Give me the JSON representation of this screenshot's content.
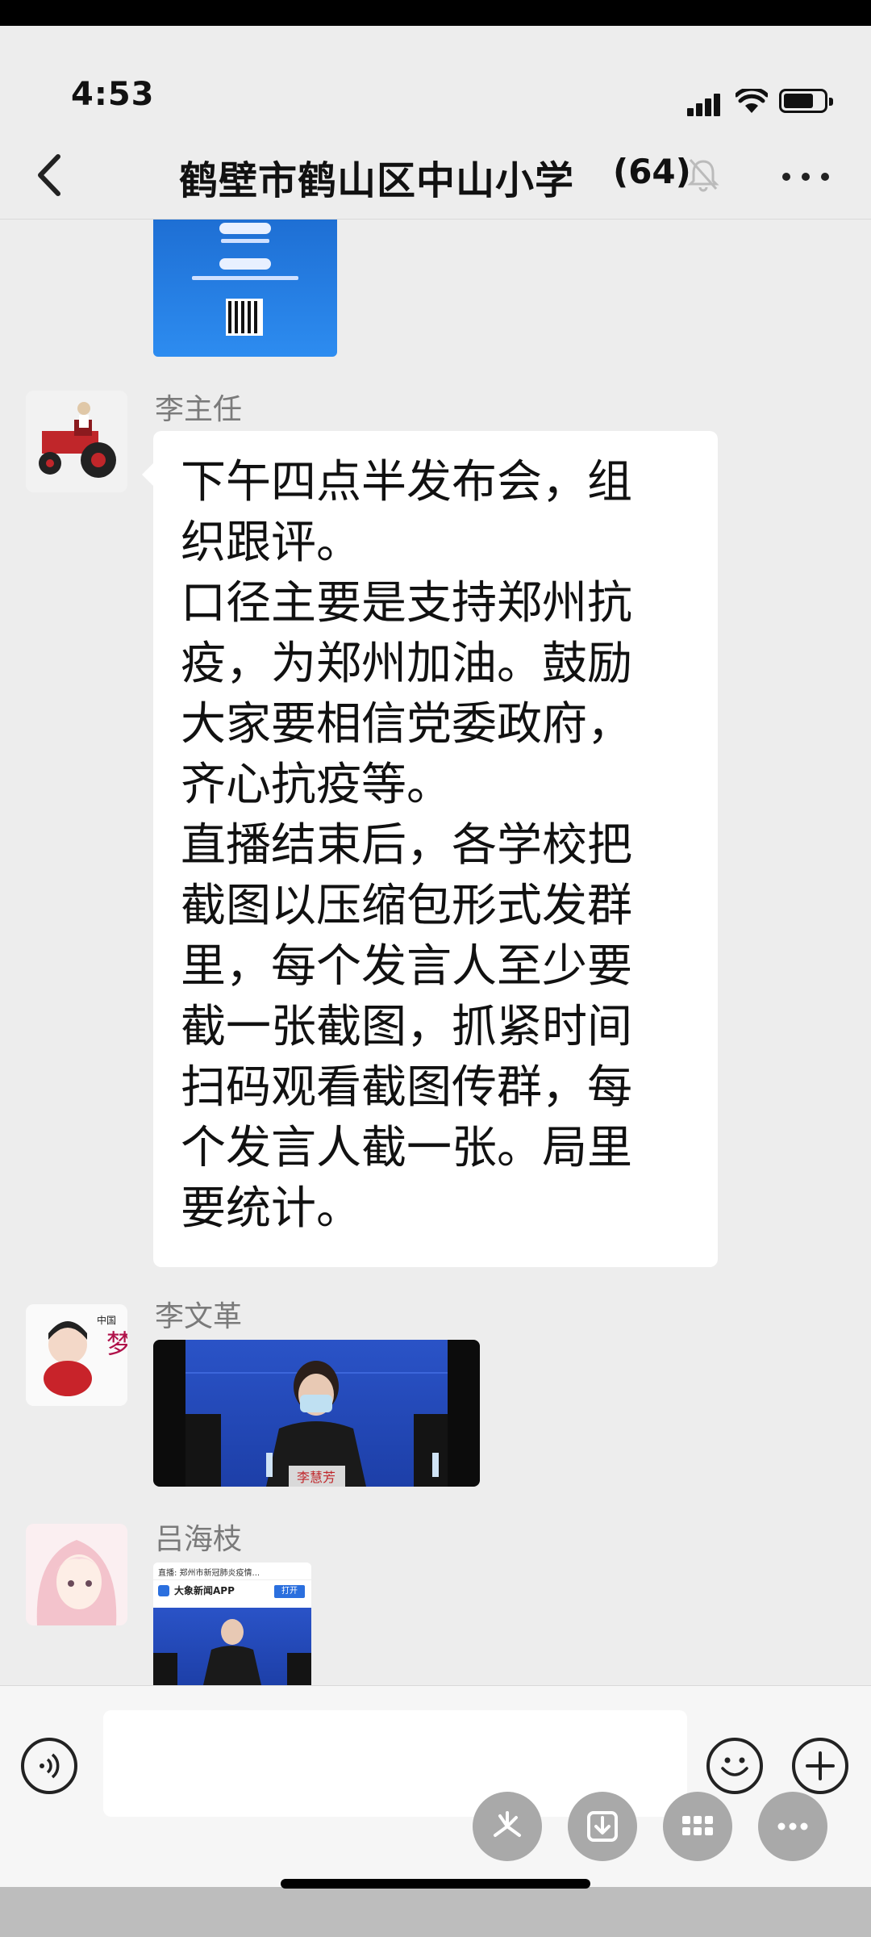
{
  "status_bar": {
    "time": "4:53"
  },
  "header": {
    "title": "鹤壁市鹤山区中山小学",
    "member_count": "(64)"
  },
  "messages": [
    {
      "type": "image",
      "desc_icon": "event-poster-image"
    },
    {
      "type": "text",
      "sender": "李主任",
      "text": "下午四点半发布会，组\n织跟评。\n口径主要是支持郑州抗\n疫，为郑州加油。鼓励\n大家要相信党委政府，\n齐心抗疫等。\n直播结束后，各学校把\n截图以压缩包形式发群\n里，每个发言人至少要\n截一张截图，抓紧时间\n扫码观看截图传群，每\n个发言人截一张。局里\n要统计。"
    },
    {
      "type": "video",
      "sender": "李文革",
      "caption": "李慧芳"
    },
    {
      "type": "image",
      "sender": "吕海枝",
      "thumb_header": "直播: 郑州市新冠肺炎疫情...",
      "thumb_app": "大象新闻APP",
      "thumb_open": "打开"
    }
  ],
  "input": {
    "placeholder": ""
  },
  "icons": {
    "back": "back-arrow-icon",
    "mute": "mute-bell-icon",
    "more": "more-dots-icon",
    "voice": "voice-icon",
    "emoji": "emoji-icon",
    "plus": "plus-icon"
  },
  "colors": {
    "bubble": "#ffffff",
    "chat_bg": "#ededed",
    "fab": "#a9a9a9"
  }
}
